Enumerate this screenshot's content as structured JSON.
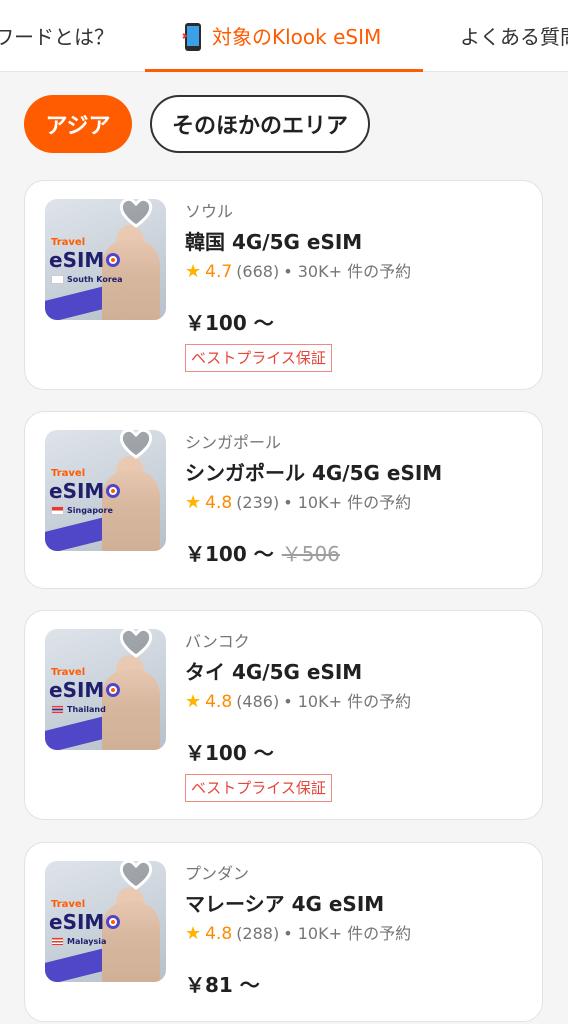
{
  "nav": {
    "tab_left": "ワードとは？",
    "tab_active": "対象のKlook eSIM",
    "tab_right": "よくある質問"
  },
  "chips": [
    "アジア",
    "そのほかのエリア"
  ],
  "cards": [
    {
      "city": "ソウル",
      "title": "韓国 4G/5G eSIM",
      "rating": "4.7",
      "reviews": "(668)",
      "bookings": "• 30K+ 件の予約",
      "price": "￥100 〜",
      "original_price": "",
      "badge": "ベストプライス保証",
      "thumb_travel": "Travel",
      "thumb_esim": "eSIM",
      "thumb_country": "South Korea"
    },
    {
      "city": "シンガポール",
      "title": "シンガポール 4G/5G eSIM",
      "rating": "4.8",
      "reviews": "(239)",
      "bookings": "• 10K+ 件の予約",
      "price": "￥100 〜",
      "original_price": "￥506",
      "badge": "",
      "thumb_travel": "Travel",
      "thumb_esim": "eSIM",
      "thumb_country": "Singapore"
    },
    {
      "city": "バンコク",
      "title": "タイ 4G/5G eSIM",
      "rating": "4.8",
      "reviews": "(486)",
      "bookings": "• 10K+ 件の予約",
      "price": "￥100 〜",
      "original_price": "",
      "badge": "ベストプライス保証",
      "thumb_travel": "Travel",
      "thumb_esim": "eSIM",
      "thumb_country": "Thailand"
    },
    {
      "city": "プンダン",
      "title": "マレーシア 4G eSIM",
      "rating": "4.8",
      "reviews": "(288)",
      "bookings": "• 10K+ 件の予約",
      "price": "￥81 〜",
      "original_price": "",
      "badge": "",
      "thumb_travel": "Travel",
      "thumb_esim": "eSIM",
      "thumb_country": "Malaysia"
    }
  ],
  "colors": {
    "accent": "#ff5b00",
    "star": "#ffb400",
    "badge": "#e6463a"
  }
}
